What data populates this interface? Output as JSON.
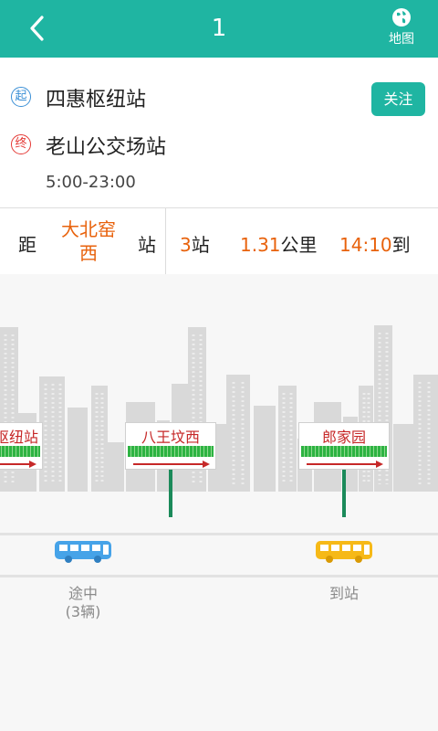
{
  "header": {
    "title": "1",
    "map_label": "地图"
  },
  "route": {
    "start_badge": "起",
    "start_stop": "四惠枢纽站",
    "end_badge": "终",
    "end_stop": "老山公交场站",
    "hours": "5:00-23:00",
    "follow_label": "关注"
  },
  "status": {
    "distance_prefix": "距",
    "target_stop": "大北窑西",
    "station_suffix": "站",
    "stops_count": "3",
    "stops_unit": "站",
    "distance_km": "1.31",
    "distance_unit": "公里",
    "arrival_time": "14:10",
    "arrival_suffix": "到"
  },
  "stops": [
    {
      "name": "四惠枢纽站",
      "visible_text": "枢纽站"
    },
    {
      "name": "八王坟西"
    },
    {
      "name": "郎家园"
    }
  ],
  "buses": [
    {
      "label": "途中",
      "sub_label": "(3辆)",
      "color": "#46a3e8"
    },
    {
      "label": "到站",
      "color": "#f6b917"
    }
  ],
  "colors": {
    "accent": "#1fb5a2",
    "highlight": "#e8620c",
    "sign_text": "#c62828",
    "pole": "#1b8a5a"
  }
}
